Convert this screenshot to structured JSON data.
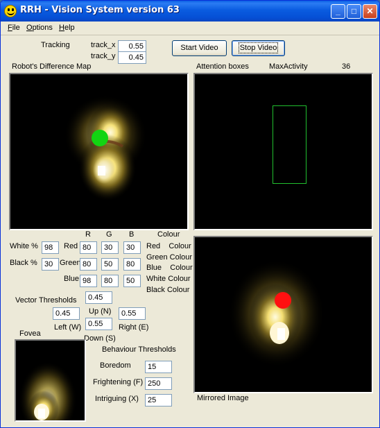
{
  "window": {
    "title": "RRH - Vision System version 63",
    "minimize_glyph": "_",
    "maximize_glyph": "□",
    "close_glyph": "✕"
  },
  "menu": {
    "file": "File",
    "options": "Options",
    "help": "Help"
  },
  "tracking": {
    "label": "Tracking",
    "track_x_label": "track_x",
    "track_x": "0.55",
    "track_y_label": "track_y",
    "track_y": "0.45"
  },
  "buttons": {
    "start_video": "Start Video",
    "stop_video": "Stop Video"
  },
  "difference_map": {
    "label": "Robot's Difference Map",
    "marker_color": "#12d412"
  },
  "attention": {
    "label": "Attention boxes",
    "max_activity_label": "MaxActivity",
    "max_activity_value": "36",
    "box_color": "#21c02f"
  },
  "colour_thresholds": {
    "header_r": "R",
    "header_g": "G",
    "header_b": "B",
    "header_colour": "Colour",
    "white_pct_label": "White %",
    "white_pct": "98",
    "black_pct_label": "Black %",
    "black_pct": "30",
    "rows": [
      {
        "label": "Red",
        "r": "80",
        "g": "30",
        "b": "30"
      },
      {
        "label": "Green",
        "r": "80",
        "g": "50",
        "b": "80"
      },
      {
        "label": "Blue",
        "r": "98",
        "g": "80",
        "b": "50"
      }
    ],
    "colour_buttons": [
      "Red Colour",
      "Green Colour",
      "Blue Colour",
      "White Colour",
      "Black Colour"
    ],
    "colour_names": {
      "red": "Red",
      "green": "Green",
      "blue": "Blue",
      "white": "White",
      "black": "Black"
    },
    "colour_word": "Colour"
  },
  "vector_thresholds": {
    "label": "Vector Thresholds",
    "top": "0.45",
    "left": "0.45",
    "up_label": "Up (N)",
    "right": "0.55",
    "left_label": "Left (W)",
    "down": "0.55",
    "right_label": "Right (E)",
    "down_label": "Down (S)"
  },
  "fovea": {
    "label": "Fovea"
  },
  "behaviour": {
    "label": "Behaviour Thresholds",
    "boredom_label": "Boredom",
    "boredom": "15",
    "frightening_label": "Frightening (F)",
    "frightening": "250",
    "intriguing_label": "Intriguing (X)",
    "intriguing": "25"
  },
  "mirrored": {
    "label": "Mirrored Image",
    "marker_color": "#ff1010"
  }
}
